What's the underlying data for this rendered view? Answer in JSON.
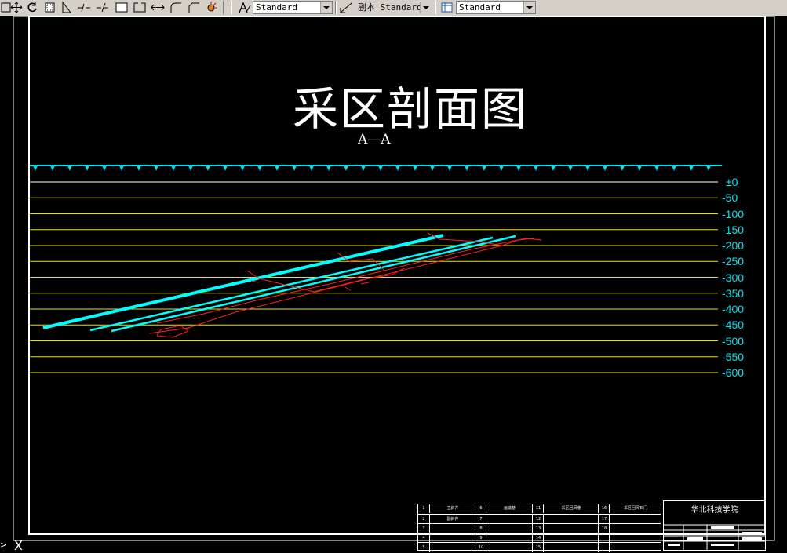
{
  "toolbar": {
    "icons": [
      "pan-icon",
      "regen-icon",
      "zoom-window-icon",
      "dimension-icon",
      "break-icon",
      "extend-icon",
      "rectangle-icon",
      "rectangle-open-icon",
      "stretch-icon",
      "fillet-icon",
      "chamfer-icon",
      "explode-icon"
    ],
    "text_style": "Standard",
    "dim_style": "副本 Standard",
    "table_style": "Standard"
  },
  "drawing": {
    "title": "采区剖面图",
    "section_label": "A—A",
    "elevation_labels": [
      "±0",
      "-50",
      "-100",
      "-150",
      "-200",
      "-250",
      "-300",
      "-350",
      "-400",
      "-450",
      "-500",
      "-550",
      "-600"
    ],
    "colors": {
      "background": "#000000",
      "frame": "#ffffff",
      "level_lines": "#e6e600",
      "seams": "#00ffff",
      "roadways": "#ff2020",
      "labels": "#00e5ee"
    }
  },
  "legend": {
    "rows": [
      [
        "1",
        "主斜井",
        "6",
        "运输巷",
        "11",
        "采区回风巷",
        "16",
        "采区回风石门"
      ],
      [
        "2",
        "副斜井",
        "7",
        "",
        "12",
        "",
        "17",
        ""
      ],
      [
        "3",
        "",
        "8",
        "",
        "13",
        "",
        "18",
        ""
      ],
      [
        "4",
        "",
        "9",
        "",
        "14",
        "",
        "",
        ""
      ],
      [
        "5",
        "",
        "10",
        "",
        "15",
        "",
        "",
        ""
      ]
    ]
  },
  "title_block": {
    "school": "华北科技学院"
  },
  "command": {
    "prompt_icon": "command-line-icon",
    "x_label": "X"
  }
}
